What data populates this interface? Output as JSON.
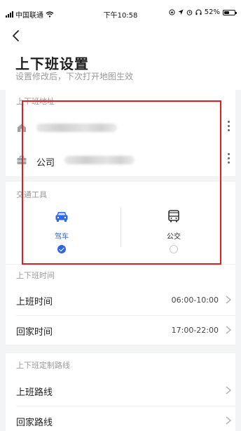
{
  "status_bar": {
    "carrier": "中国联通",
    "time": "下午10:58",
    "battery_text": "52%",
    "battery_level": 0.52
  },
  "header": {
    "title": "上下班设置",
    "subtitle": "设置修改后，下次打开地图生效"
  },
  "address_section": {
    "label": "上下班地址",
    "rows": [
      {
        "icon": "home-icon",
        "name": "",
        "address_obscured": true
      },
      {
        "icon": "briefcase-icon",
        "name": "公司",
        "address_obscured": true
      }
    ]
  },
  "transport_section": {
    "label": "交通工具",
    "options": [
      {
        "label": "驾车",
        "icon": "car-icon",
        "selected": true
      },
      {
        "label": "公交",
        "icon": "bus-icon",
        "selected": false
      }
    ]
  },
  "time_section": {
    "label": "上下班时间",
    "rows": [
      {
        "label": "上班时间",
        "value": "06:00-10:00"
      },
      {
        "label": "回家时间",
        "value": "17:00-22:00"
      }
    ]
  },
  "route_section": {
    "label": "上下班定制路线",
    "rows": [
      {
        "label": "上班路线"
      },
      {
        "label": "回家路线"
      }
    ]
  },
  "colors": {
    "accent": "#2f66e4",
    "highlight_box": "#e21d1d",
    "page_bg": "#f3f4f6"
  }
}
